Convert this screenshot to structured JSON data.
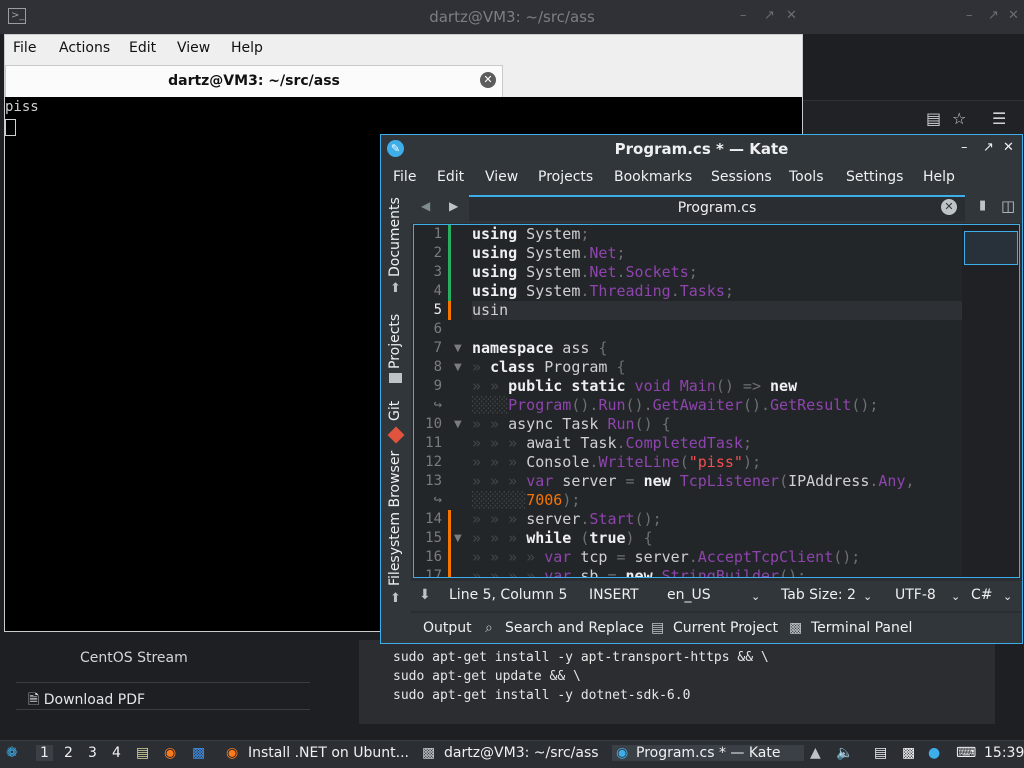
{
  "desktop": {
    "top_title": "dartz@VM3: ~/src/ass",
    "top_icon": "terminal-icon"
  },
  "browser_background": {
    "centos_link": "CentOS Stream",
    "download_pdf": "Download PDF",
    "code_lines": [
      "sudo apt-get install -y apt-transport-https && \\",
      "sudo apt-get update && \\",
      "sudo apt-get install -y dotnet-sdk-6.0"
    ]
  },
  "terminal": {
    "menu": [
      "File",
      "Actions",
      "Edit",
      "View",
      "Help"
    ],
    "tab_title": "dartz@VM3: ~/src/ass",
    "output": "piss"
  },
  "kate": {
    "title": "Program.cs * — Kate",
    "menu": [
      "File",
      "Edit",
      "View",
      "Projects",
      "Bookmarks",
      "Sessions",
      "Tools",
      "Settings",
      "Help"
    ],
    "side_panels": [
      "Documents",
      "Projects",
      "Git",
      "Filesystem Browser"
    ],
    "tab": "Program.cs",
    "status": {
      "position": "Line 5, Column 5",
      "mode": "INSERT",
      "language": "en_US",
      "tab_size": "Tab Size: 2",
      "encoding": "UTF-8",
      "syntax": "C#"
    },
    "tool_views": [
      "Output",
      "Search and Replace",
      "Current Project",
      "Terminal Panel"
    ]
  },
  "taskbar": {
    "workspaces": [
      "1",
      "2",
      "3",
      "4"
    ],
    "tasks": [
      "Install .NET on Ubunt...",
      "dartz@VM3: ~/src/ass",
      "Program.cs * — Kate"
    ],
    "clock": "15:39"
  },
  "colors": {
    "accent": "#3daee9",
    "keyword": "#eff0f1",
    "type": "#8e44ad",
    "string": "#f44f4f",
    "number": "#f67400",
    "saved_marker": "#27ae60",
    "modified_marker": "#f67400"
  }
}
